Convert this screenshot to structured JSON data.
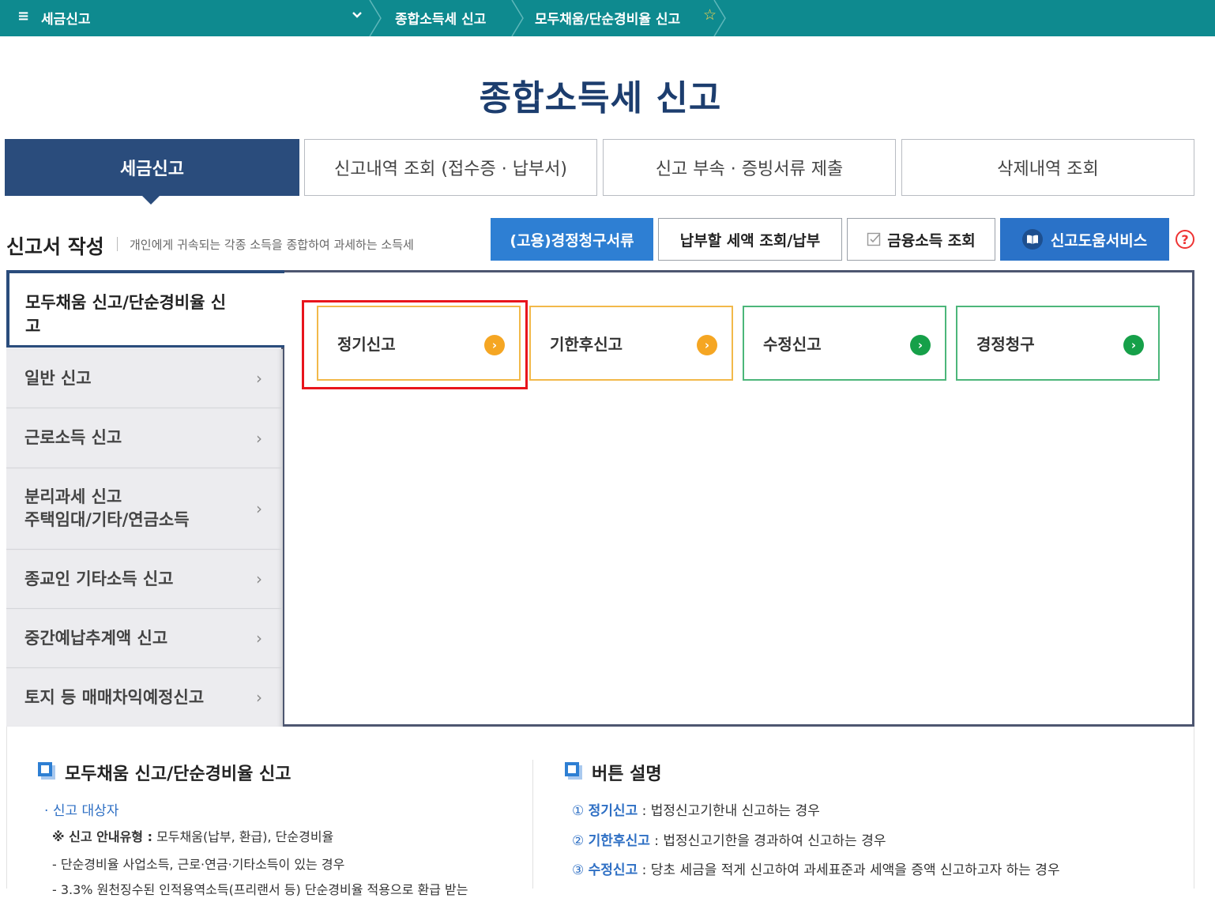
{
  "topbar": {
    "menu_icon": "≡",
    "section": "세금신고",
    "crumb1": "종합소득세 신고",
    "crumb2": "모두채움/단순경비율 신고",
    "favorite_icon": "☆"
  },
  "page_title": "종합소득세 신고",
  "tabs": [
    {
      "label": "세금신고",
      "active": true
    },
    {
      "label": "신고내역 조회 (접수증 · 납부서)"
    },
    {
      "label": "신고 부속 · 증빙서류 제출"
    },
    {
      "label": "삭제내역 조회"
    }
  ],
  "section": {
    "title": "신고서 작성",
    "desc": "개인에게 귀속되는 각종 소득을 종합하여 과세하는 소득세"
  },
  "action_buttons": {
    "b1": "(고용)경정청구서류",
    "b2": "납부할 세액 조회/납부",
    "b3": "금융소득 조회",
    "b4": "신고도움서비스",
    "help": "?"
  },
  "left_menu": {
    "active": "모두채움 신고/단순경비율 신고",
    "items": [
      {
        "label": "일반 신고"
      },
      {
        "label": "근로소득 신고"
      },
      {
        "label": "분리과세 신고\n주택임대/기타/연금소득"
      },
      {
        "label": "종교인 기타소득 신고"
      },
      {
        "label": "중간예납추계액 신고"
      },
      {
        "label": "토지 등 매매차익예정신고"
      }
    ]
  },
  "cards": [
    {
      "label": "정기신고",
      "color": "#f5a623"
    },
    {
      "label": "기한후신고",
      "color": "#f5a623"
    },
    {
      "label": "수정신고",
      "color": "#16a049"
    },
    {
      "label": "경정청구",
      "color": "#16a049"
    }
  ],
  "bottom_left": {
    "heading": "모두채움 신고/단순경비율 신고",
    "target_label": "신고 대상자",
    "note_prefix": "※ 신고 안내유형 :",
    "note_text": " 모두채움(납부, 환급), 단순경비율",
    "line1": "- 단순경비율 사업소득, 근로·연금·기타소득이 있는 경우",
    "line2": "- 3.3% 원천징수된 인적용역소득(프리랜서 등) 단순경비율 적용으로 환급 받는"
  },
  "bottom_right": {
    "heading": "버튼 설명",
    "items": [
      {
        "num": "①",
        "name": "정기신고",
        "desc": " : 법정신고기한내 신고하는 경우"
      },
      {
        "num": "②",
        "name": "기한후신고",
        "desc": " : 법정신고기한을 경과하여 신고하는 경우"
      },
      {
        "num": "③",
        "name": "수정신고",
        "desc": " : 당초 세금을 적게 신고하여 과세표준과 세액을 증액 신고하고자 하는 경우"
      }
    ]
  },
  "colors": {
    "topbar": "#0e8a8f",
    "navy": "#2a4c7c",
    "blue_button": "#2e7fd3",
    "highlight": "#e8141c"
  }
}
